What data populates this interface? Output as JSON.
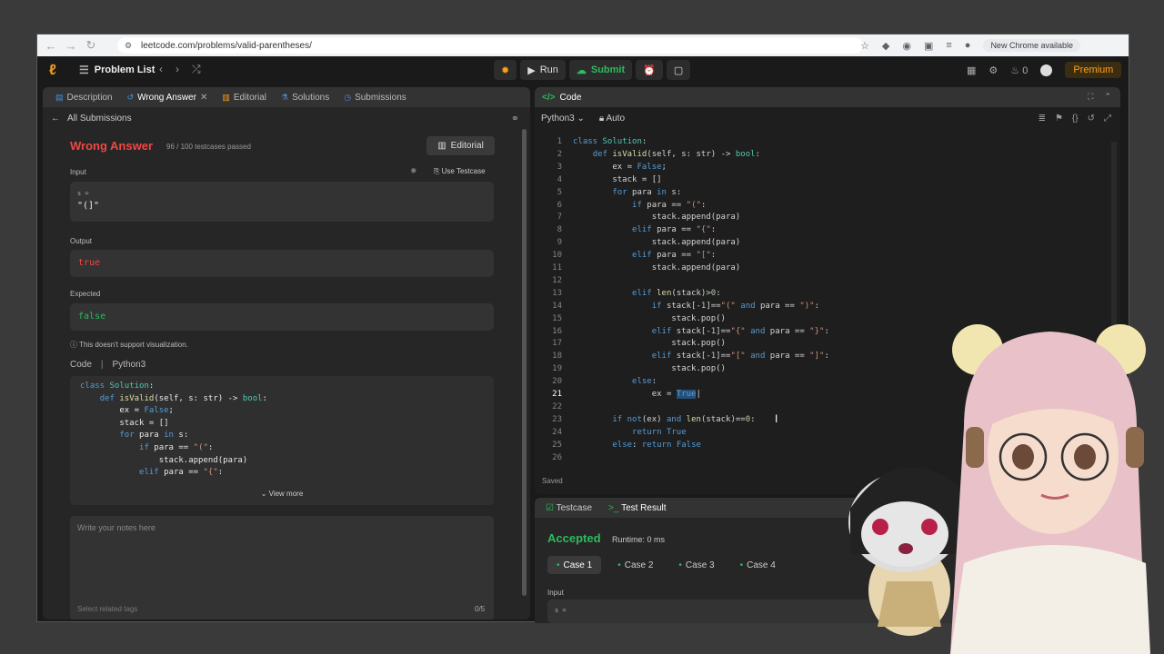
{
  "browser": {
    "url": "leetcode.com/problems/valid-parentheses/",
    "update_label": "New Chrome available"
  },
  "top": {
    "problem_list": "Problem List",
    "run": "Run",
    "submit": "Submit",
    "streak": "0",
    "premium": "Premium"
  },
  "left": {
    "tabs": [
      {
        "label": "Description"
      },
      {
        "label": "Wrong Answer"
      },
      {
        "label": "Editorial"
      },
      {
        "label": "Solutions"
      },
      {
        "label": "Submissions"
      }
    ],
    "all_submissions": "All Submissions",
    "status": "Wrong Answer",
    "testcases": "96 / 100 testcases passed",
    "editorial_btn": "Editorial",
    "input_label": "Input",
    "use_testcase": "Use Testcase",
    "input_var": "s =",
    "input_value": "\"(]\"",
    "output_label": "Output",
    "output_value": "true",
    "expected_label": "Expected",
    "expected_value": "false",
    "no_visual": "This doesn't support visualization.",
    "code_label": "Code",
    "code_lang": "Python3",
    "view_more": "View more",
    "notes_placeholder": "Write your notes here",
    "tags_placeholder": "Select related tags",
    "tags_count": "0/5"
  },
  "editor": {
    "title": "Code",
    "language": "Python3",
    "mode": "Auto",
    "saved": "Saved",
    "current_line": 21
  },
  "bottom": {
    "tab_testcase": "Testcase",
    "tab_result": "Test Result",
    "status": "Accepted",
    "runtime": "Runtime: 0 ms",
    "cases": [
      "Case 1",
      "Case 2",
      "Case 3",
      "Case 4"
    ],
    "input_label": "Input",
    "input_var": "s ="
  }
}
